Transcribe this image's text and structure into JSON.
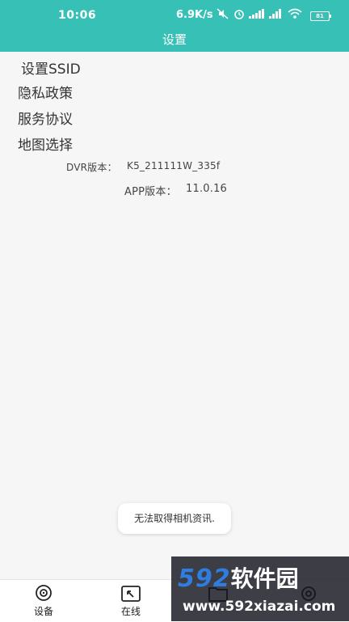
{
  "status_bar": {
    "time": "10:06",
    "net_speed": "6.9K/s",
    "battery": "81"
  },
  "app_bar": {
    "title": "设置"
  },
  "menu": {
    "items": [
      {
        "label": "设置SSID"
      },
      {
        "label": "隐私政策"
      },
      {
        "label": "服务协议"
      },
      {
        "label": "地图选择"
      }
    ]
  },
  "versions": {
    "dvr_label": "DVR版本：",
    "dvr_value": "K5_211111W_335f",
    "app_label": "APP版本：",
    "app_value": "11.0.16"
  },
  "toast": {
    "message": "无法取得相机资讯."
  },
  "bottom_nav": {
    "tabs": [
      {
        "label": "设备",
        "icon": "camera-icon"
      },
      {
        "label": "在线",
        "icon": "online-icon"
      },
      {
        "label": "",
        "icon": "folder-icon"
      },
      {
        "label": "",
        "icon": "settings-icon"
      }
    ]
  },
  "watermark": {
    "brand_digits": "592",
    "brand_text": "软件园",
    "url": "www.592xiazai.com"
  },
  "colors": {
    "accent": "#37c1b6",
    "watermark_blue": "#2f7de1"
  }
}
